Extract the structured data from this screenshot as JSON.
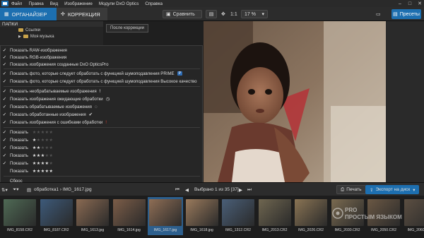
{
  "menubar": {
    "items": [
      "Файл",
      "Правка",
      "Вид",
      "Изображение",
      "Модули DxO Optics",
      "Справка"
    ]
  },
  "toolbar": {
    "tab_organizer": "ОРГАНАЙЗЕР",
    "tab_correction": "КОРРЕКЦИЯ",
    "compare": "Сравнить",
    "zoom_fit": "1:1",
    "zoom_level": "17 %",
    "presets": "Пресеты"
  },
  "left_panel": {
    "header": "ПАПКИ",
    "folders": [
      "Ссылки",
      "Моя музыка"
    ]
  },
  "tooltip": "После коррекции",
  "menu": {
    "items": [
      "Показать RAW-изображения",
      "Показать RGB-изображения",
      "Показать изображения созданные DxO OpticsPro",
      "Показать фото, которые следует обработать с функцией шумоподавления PRIME",
      "Показать фото, которые следует обработать с функцией шумоподавления Высокое качество",
      "Показать необрабатываемые изображения",
      "Показать изображения ожидающие обработки",
      "Показать обрабатываемые изображения",
      "Показать обработанные изображения",
      "Показать изображения с ошибками обработки",
      "Показать",
      "Показать",
      "Показать",
      "Показать",
      "Показать",
      "Показать",
      "Сброс"
    ],
    "rating_stars": [
      0,
      1,
      2,
      3,
      4,
      5
    ],
    "prime_badge": "P"
  },
  "bottombar": {
    "breadcrumb": "обработка1 › IMG_1617.jpg",
    "selected_count": "Выбрано 1 из 35 [37]",
    "print": "Печать",
    "export": "Экспорт на диск"
  },
  "filmstrip": {
    "thumbs": [
      {
        "name": "IMG_8158.CR2",
        "color": "#4f6a55"
      },
      {
        "name": "IMG_8187.CR2",
        "color": "#3d5a7a"
      },
      {
        "name": "IMG_1613.jpg",
        "color": "#8a6a52"
      },
      {
        "name": "IMG_1614.jpg",
        "color": "#7c5d48"
      },
      {
        "name": "IMG_1617.jpg",
        "color": "#8f6e55"
      },
      {
        "name": "IMG_1618.jpg",
        "color": "#9a7a5c"
      },
      {
        "name": "IMG_1312.CR2",
        "color": "#4a5f78"
      },
      {
        "name": "IMG_2013.CR2",
        "color": "#6f6650"
      },
      {
        "name": "IMG_2026.CR2",
        "color": "#8a7454"
      },
      {
        "name": "IMG_2030.CR2",
        "color": "#7a6a50"
      },
      {
        "name": "IMG_2050.CR2",
        "color": "#6b5844"
      },
      {
        "name": "IMG_2060.CR2",
        "color": "#5c4f42"
      }
    ],
    "selected_index": 4
  },
  "watermark": "PRO ПРОСТЫМ ЯЗЫКОМ",
  "colors": {
    "accent": "#1d6fb0",
    "prime_badge": "#2f6db5",
    "error_mark": "#d23a2a"
  }
}
